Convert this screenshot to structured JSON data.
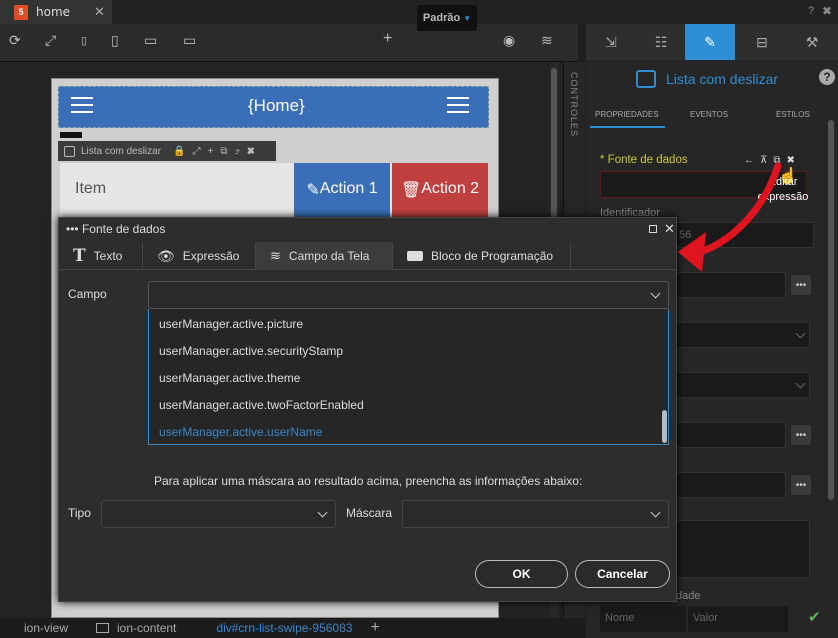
{
  "tab": {
    "label": "home",
    "close": "✕"
  },
  "toolbar": {
    "preset": "Padrão"
  },
  "phone": {
    "title": "{Home}",
    "list_tag": "Lista com deslizar",
    "item": "Item",
    "action1": "Action 1",
    "action2": "Action 2"
  },
  "side": {
    "controles": "CONTROLES"
  },
  "right": {
    "title": "Lista com deslizar",
    "tabs": [
      "PROPRIEDADES",
      "EVENTOS",
      "ESTILOS"
    ],
    "fonte": "* Fonte de dados",
    "tooltip_line1": "Editar",
    "tooltip_line2": "expressão",
    "identificador": "Identificador",
    "ident_frag": "56",
    "dade": "dade",
    "nome_ph": "Nome",
    "valor_ph": "Valor"
  },
  "dialog": {
    "title": "Fonte de dados",
    "tabs": [
      "Texto",
      "Expressão",
      "Campo da Tela",
      "Bloco de Programação"
    ],
    "campo": "Campo",
    "options": [
      "userManager.active.picture",
      "userManager.active.securityStamp",
      "userManager.active.theme",
      "userManager.active.twoFactorEnabled",
      "userManager.active.userName"
    ],
    "mask_info": "Para aplicar uma máscara ao resultado acima, preencha as informações abaixo:",
    "tipo": "Tipo",
    "mascara": "Máscara",
    "ok": "OK",
    "cancel": "Cancelar"
  },
  "status": {
    "crumbs": [
      "ion-view",
      "ion-content",
      "div#crn-list-swipe-956083"
    ]
  },
  "colors": {
    "accent": "#2e8fd4",
    "selected_option": "#3a86c8",
    "fonte_label": "#c8c840",
    "arrow": "#e0141e"
  }
}
